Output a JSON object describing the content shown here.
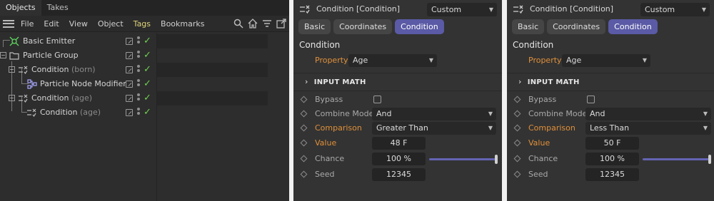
{
  "objects_manager": {
    "tabs": [
      "Objects",
      "Takes"
    ],
    "menu": [
      "File",
      "Edit",
      "View",
      "Object",
      "Tags",
      "Bookmarks"
    ],
    "toolbar_icons": [
      "search-icon",
      "home-icon",
      "filter-icon",
      "new-window-icon"
    ],
    "tree": [
      {
        "name": "Basic Emitter",
        "suffix": "",
        "icon": "emitter-icon"
      },
      {
        "name": "Particle Group",
        "suffix": "",
        "icon": "folder-icon"
      },
      {
        "name": "Condition",
        "suffix": "(born)",
        "icon": "condition-icon"
      },
      {
        "name": "Particle Node Modifier",
        "suffix": "",
        "icon": "node-modifier-icon"
      },
      {
        "name": "Condition",
        "suffix": "(age)",
        "icon": "condition-icon"
      },
      {
        "name": "Condition",
        "suffix": "(age)",
        "icon": "condition-icon"
      }
    ],
    "colors": {
      "enabled_check": "#6fd14f",
      "tags_menu": "#e0d27a"
    }
  },
  "attribute_panels": [
    {
      "title": "Condition [Condition]",
      "mode": "Custom",
      "tabs": [
        "Basic",
        "Coordinates",
        "Condition"
      ],
      "active_tab": "Condition",
      "section": "Condition",
      "property_label": "Property",
      "property_value": "Age",
      "group": "INPUT MATH",
      "rows": {
        "bypass": {
          "label": "Bypass",
          "checked": false
        },
        "combine_mode": {
          "label": "Combine Mode",
          "value": "And"
        },
        "comparison": {
          "label": "Comparison",
          "value": "Greater Than"
        },
        "value": {
          "label": "Value",
          "value": "48 F"
        },
        "chance": {
          "label": "Chance",
          "value": "100 %",
          "fraction": 1.0
        },
        "seed": {
          "label": "Seed",
          "value": "12345"
        }
      }
    },
    {
      "title": "Condition [Condition]",
      "mode": "Custom",
      "tabs": [
        "Basic",
        "Coordinates",
        "Condition"
      ],
      "active_tab": "Condition",
      "section": "Condition",
      "property_label": "Property",
      "property_value": "Age",
      "group": "INPUT MATH",
      "rows": {
        "bypass": {
          "label": "Bypass",
          "checked": false
        },
        "combine_mode": {
          "label": "Combine Mode",
          "value": "And"
        },
        "comparison": {
          "label": "Comparison",
          "value": "Less Than"
        },
        "value": {
          "label": "Value",
          "value": "50 F"
        },
        "chance": {
          "label": "Chance",
          "value": "100 %",
          "fraction": 1.0
        },
        "seed": {
          "label": "Seed",
          "value": "12345"
        }
      }
    }
  ],
  "accent_colors": {
    "active_tab": "#5a5aa6",
    "animated_label": "#e0903a",
    "slider": "#6464b4"
  }
}
